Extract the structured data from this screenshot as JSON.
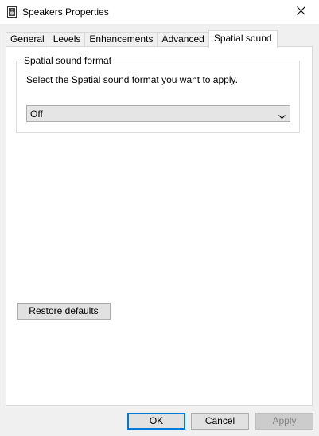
{
  "window": {
    "title": "Speakers Properties",
    "icon": "speaker-icon",
    "close_icon": "close-icon"
  },
  "tabs": [
    {
      "label": "General",
      "active": false
    },
    {
      "label": "Levels",
      "active": false
    },
    {
      "label": "Enhancements",
      "active": false
    },
    {
      "label": "Advanced",
      "active": false
    },
    {
      "label": "Spatial sound",
      "active": true
    }
  ],
  "spatial": {
    "group_label": "Spatial sound format",
    "description": "Select the Spatial sound format you want to apply.",
    "format_selected": "Off"
  },
  "buttons": {
    "restore_defaults": "Restore defaults",
    "ok": "OK",
    "cancel": "Cancel",
    "apply": "Apply",
    "apply_enabled": false
  },
  "colors": {
    "accent": "#0078d7",
    "panel_bg": "#ffffff",
    "window_bg": "#f0f0f0",
    "disabled_text": "#838383"
  }
}
